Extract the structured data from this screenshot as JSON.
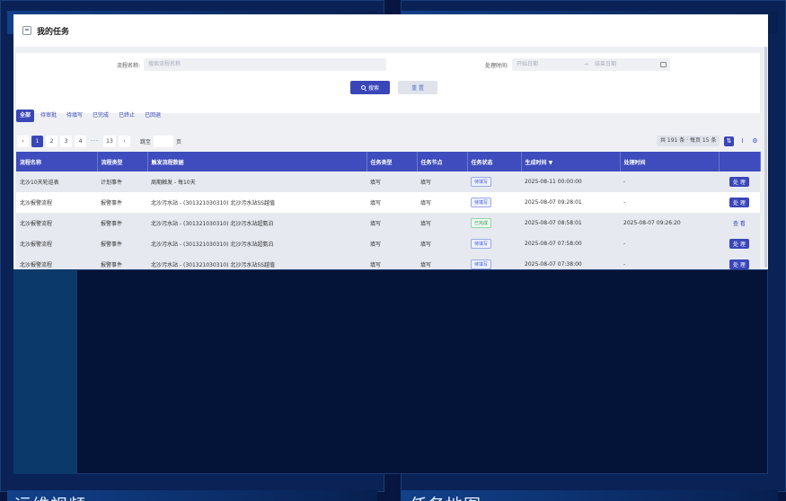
{
  "dashboard": {
    "bottom_left_title": "运维视频",
    "bottom_right_title": "任务地图"
  },
  "modal": {
    "title": "我的任务",
    "filter": {
      "process_name_label": "流程名称:",
      "process_name_placeholder": "搜索流程名称",
      "time_label": "处理时间:",
      "start_placeholder": "开始日期",
      "arrow": "→",
      "end_placeholder": "结束日期",
      "search_label": "搜索",
      "reset_label": "重 置"
    },
    "tabs": [
      "全部",
      "待审批",
      "待填写",
      "已完成",
      "已终止",
      "已回退"
    ],
    "pager": {
      "prev": "‹",
      "pages": [
        "1",
        "2",
        "3",
        "4"
      ],
      "ellipsis": "···",
      "last": "13",
      "next": "›",
      "jump_label": "跳至",
      "jump_suffix": "页",
      "total": "共 191 条 · 每页 15 条"
    },
    "table": {
      "headers": [
        "流程名称",
        "流程类型",
        "触发流程数据",
        "任务类型",
        "任务节点",
        "任务状态",
        "生成时间 ▼",
        "处理时间",
        ""
      ],
      "rows": [
        {
          "name": "北沙10天轮巡表",
          "type": "计划事件",
          "trigger": "周期触发 - 每10天",
          "task_type": "填写",
          "node": "填写",
          "status": "待填写",
          "created": "2025-08-11 00:00:00",
          "handled": "-",
          "action": "处 理"
        },
        {
          "name": "北沙报警流程",
          "type": "报警事件",
          "trigger": "北沙污水站 - (301321030310) 北沙污水站SS越值",
          "task_type": "填写",
          "node": "填写",
          "status": "待填写",
          "created": "2025-08-07 09:28:01",
          "handled": "-",
          "action": "处 理"
        },
        {
          "name": "北沙报警流程",
          "type": "报警事件",
          "trigger": "北沙污水站 - (301321030310) 北沙污水站超氨泊",
          "task_type": "填写",
          "node": "填写",
          "status": "已完成",
          "created": "2025-08-07 08:58:01",
          "handled": "2025-08-07 09:26:20",
          "action": "查 看"
        },
        {
          "name": "北沙报警流程",
          "type": "报警事件",
          "trigger": "北沙污水站 - (301321030310) 北沙污水站超氨泊",
          "task_type": "填写",
          "node": "填写",
          "status": "待填写",
          "created": "2025-08-07 07:58:00",
          "handled": "-",
          "action": "处 理"
        },
        {
          "name": "北沙报警流程",
          "type": "报警事件",
          "trigger": "北沙污水站 - (301321030310) 北沙污水站SS越值",
          "task_type": "填写",
          "node": "填写",
          "status": "待填写",
          "created": "2025-08-07 07:38:00",
          "handled": "-",
          "action": "处 理"
        }
      ]
    }
  }
}
